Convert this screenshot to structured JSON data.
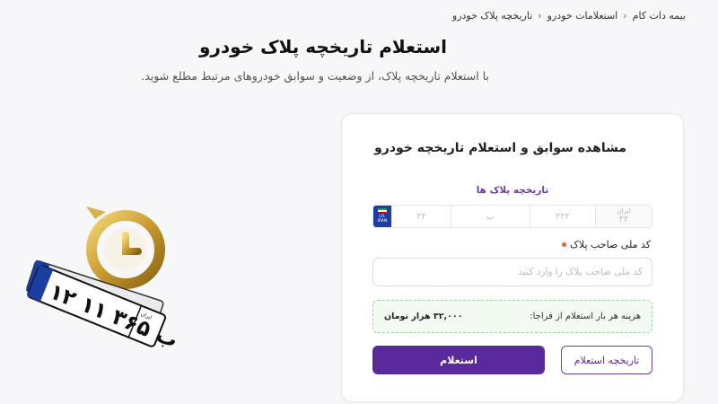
{
  "breadcrumb": {
    "items": [
      "بیمه دات کام",
      "استعلامات خودرو",
      "تاریخچه پلاک خودرو"
    ]
  },
  "page": {
    "title": "استعلام تاریخچه پلاک خودرو",
    "subtitle": "با استعلام تاریخچه پلاک، از وضعیت و سوابق خودروهای مرتبط مطلع شوید."
  },
  "card": {
    "title": "مشاهده سوابق و استعلام تاریخچه خودرو",
    "plate_label": "تاریخچه پلاک ها",
    "plate": {
      "flag_text_1": "I.R.",
      "flag_text_2": "IRAN",
      "part1_placeholder": "۲۲",
      "part2_placeholder": "ب",
      "part3_placeholder": "۲۲۲",
      "region_label": "ایران",
      "region_placeholder": "۲۲"
    },
    "national_code": {
      "label": "کد ملی صاحب پلاک",
      "placeholder": "کد ملی صاحب پلاک را وارد کنید",
      "value": ""
    },
    "cost": {
      "label": "هزینه هر بار استعلام از فراجا:",
      "value": "۳۲,۰۰۰ هزار تومان"
    },
    "buttons": {
      "submit": "استعلام",
      "history": "تاریخچه استعلام"
    }
  },
  "illustration": {
    "plate_text": "۱۲ ب ۳۶۵ ۱۱",
    "plate_region": "ایران"
  },
  "colors": {
    "accent": "#5a2a9c",
    "required": "#e8632c",
    "cost_bg": "#f2faf2"
  }
}
